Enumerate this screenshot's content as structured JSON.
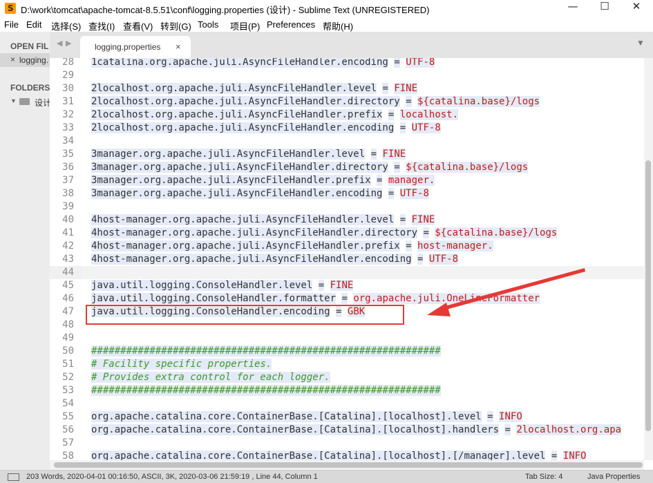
{
  "window": {
    "title": "D:\\work\\tomcat\\apache-tomcat-8.5.51\\conf\\logging.properties (设计) - Sublime Text (UNREGISTERED)",
    "app_icon": "S",
    "minimize_glyph": "—",
    "maximize_glyph": "☐",
    "close_glyph": "✕"
  },
  "menu": [
    "File",
    "Edit",
    "选择(S)",
    "查找(I)",
    "查看(V)",
    "转到(G)",
    "Tools",
    "项目(P)",
    "Preferences",
    "帮助(H)"
  ],
  "sidebar": {
    "open_files_header": "OPEN FIL",
    "open_file_close": "×",
    "open_file_name": "logging.",
    "folders_header": "FOLDERS",
    "folder_toggle": "▼",
    "folder_name": "设计"
  },
  "tabbar": {
    "nav_left": "◀",
    "nav_right": "▶",
    "tab_label": "logging.properties",
    "tab_close": "×",
    "menu_arrow": "▼"
  },
  "editor": {
    "current_line": 44,
    "lines": [
      {
        "n": "28",
        "text": "1catalina.org.apache.juli.AsyncFileHandler.encoding = UTF-8"
      },
      {
        "n": "29",
        "text": ""
      },
      {
        "n": "30",
        "text": "2localhost.org.apache.juli.AsyncFileHandler.level = FINE"
      },
      {
        "n": "31",
        "text": "2localhost.org.apache.juli.AsyncFileHandler.directory = ${catalina.base}/logs"
      },
      {
        "n": "32",
        "text": "2localhost.org.apache.juli.AsyncFileHandler.prefix = localhost."
      },
      {
        "n": "33",
        "text": "2localhost.org.apache.juli.AsyncFileHandler.encoding = UTF-8"
      },
      {
        "n": "34",
        "text": ""
      },
      {
        "n": "35",
        "text": "3manager.org.apache.juli.AsyncFileHandler.level = FINE"
      },
      {
        "n": "36",
        "text": "3manager.org.apache.juli.AsyncFileHandler.directory = ${catalina.base}/logs"
      },
      {
        "n": "37",
        "text": "3manager.org.apache.juli.AsyncFileHandler.prefix = manager."
      },
      {
        "n": "38",
        "text": "3manager.org.apache.juli.AsyncFileHandler.encoding = UTF-8"
      },
      {
        "n": "39",
        "text": ""
      },
      {
        "n": "40",
        "text": "4host-manager.org.apache.juli.AsyncFileHandler.level = FINE"
      },
      {
        "n": "41",
        "text": "4host-manager.org.apache.juli.AsyncFileHandler.directory = ${catalina.base}/logs"
      },
      {
        "n": "42",
        "text": "4host-manager.org.apache.juli.AsyncFileHandler.prefix = host-manager."
      },
      {
        "n": "43",
        "text": "4host-manager.org.apache.juli.AsyncFileHandler.encoding = UTF-8"
      },
      {
        "n": "44",
        "text": ""
      },
      {
        "n": "45",
        "text": "java.util.logging.ConsoleHandler.level = FINE"
      },
      {
        "n": "46",
        "text": "java.util.logging.ConsoleHandler.formatter = org.apache.juli.OneLineFormatter"
      },
      {
        "n": "47",
        "text": "java.util.logging.ConsoleHandler.encoding = GBK"
      },
      {
        "n": "48",
        "text": ""
      },
      {
        "n": "49",
        "text": ""
      },
      {
        "n": "50",
        "text": "############################################################"
      },
      {
        "n": "51",
        "text": "# Facility specific properties."
      },
      {
        "n": "52",
        "text": "# Provides extra control for each logger."
      },
      {
        "n": "53",
        "text": "############################################################"
      },
      {
        "n": "54",
        "text": ""
      },
      {
        "n": "55",
        "text": "org.apache.catalina.core.ContainerBase.[Catalina].[localhost].level = INFO"
      },
      {
        "n": "56",
        "text": "org.apache.catalina.core.ContainerBase.[Catalina].[localhost].handlers = 2localhost.org.apa"
      },
      {
        "n": "57",
        "text": ""
      },
      {
        "n": "58",
        "text": "org.apache.catalina.core.ContainerBase.[Catalina].[localhost].[/manager].level = INFO"
      }
    ]
  },
  "status": {
    "info": "203 Words, 2020-04-01 00:16:50, ASCII, 3K, 2020-03-06 21:59:19 , Line 44, Column 1",
    "tab_size": "Tab Size: 4",
    "syntax": "Java Properties"
  },
  "colors": {
    "value": "#c41a16",
    "comment": "#3c9a2b",
    "highlight": "#e4eaf7",
    "annotation": "#e53935"
  }
}
